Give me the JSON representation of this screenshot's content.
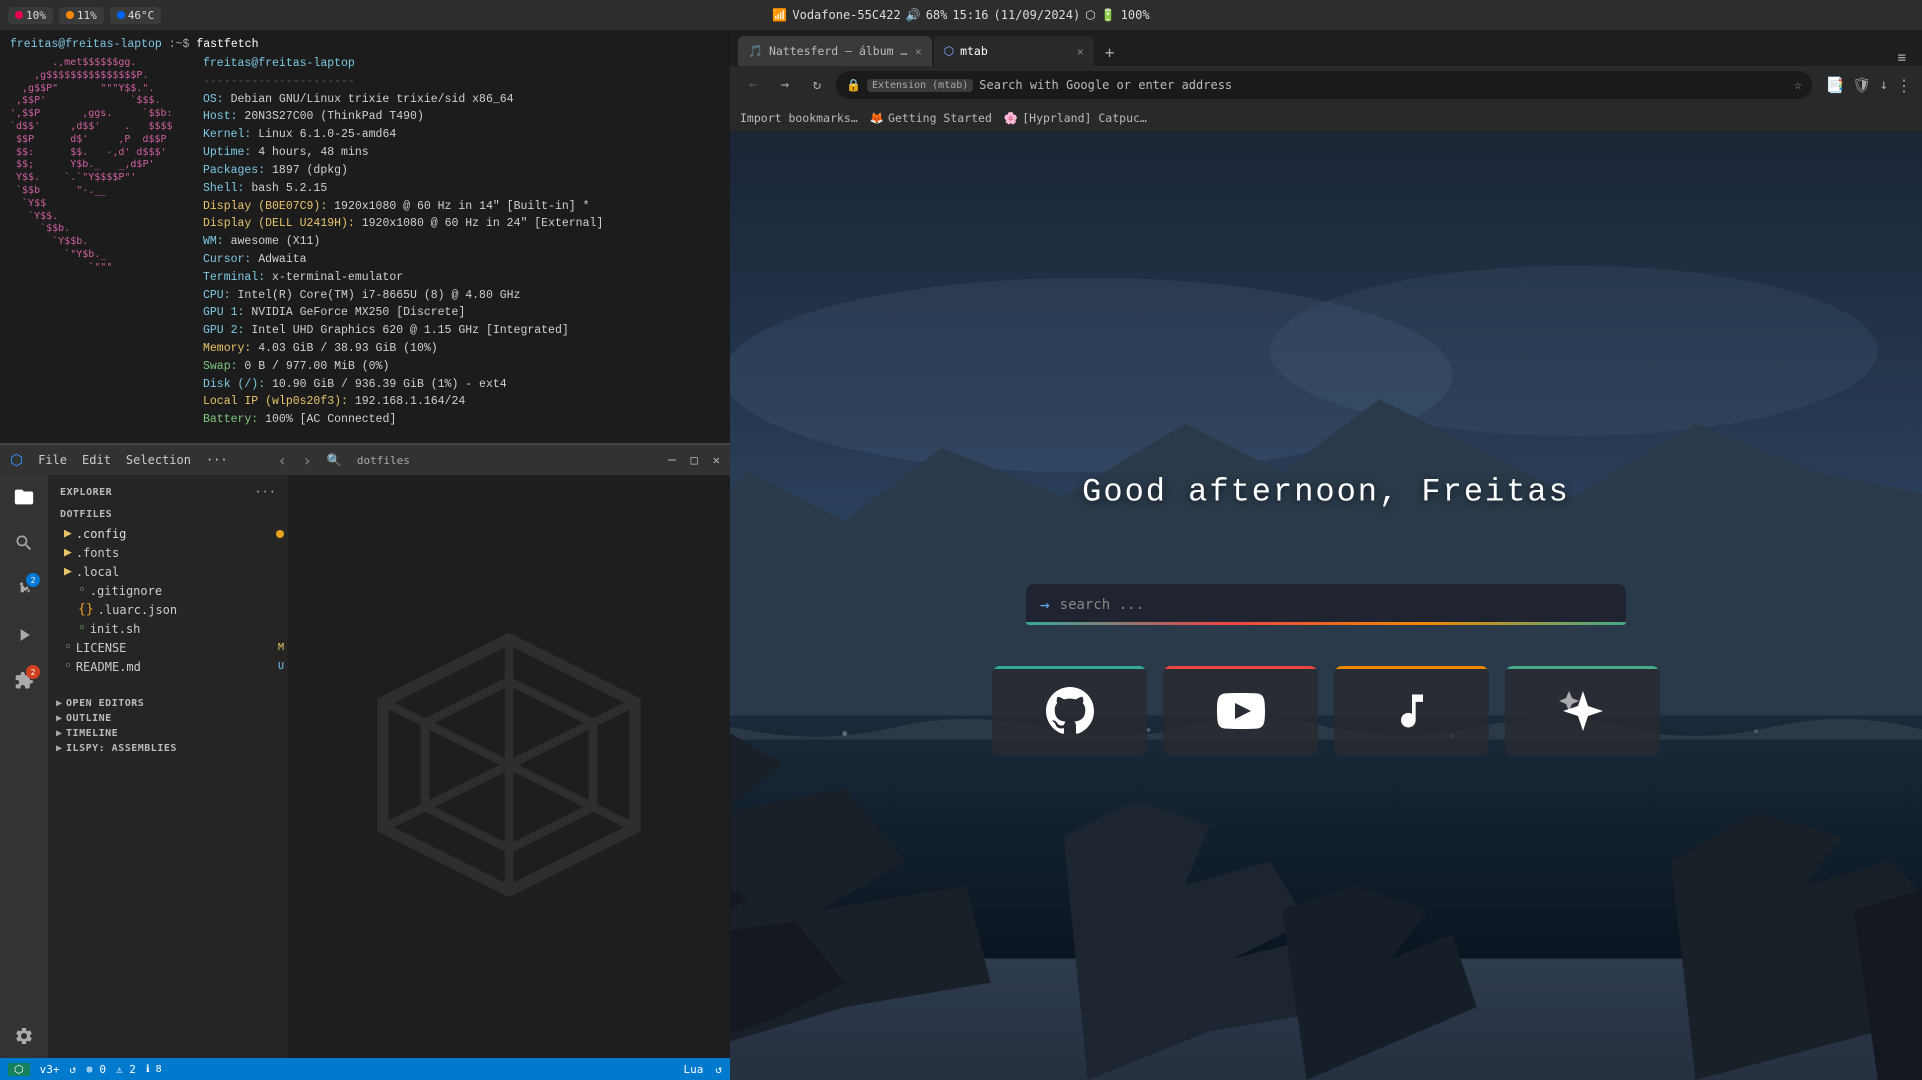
{
  "topbar": {
    "pills": [
      {
        "icon": "dot-red",
        "label": "10%",
        "name": "cpu-pill"
      },
      {
        "icon": "dot-orange",
        "label": "11%",
        "name": "ram-pill"
      },
      {
        "icon": "dot-blue",
        "label": "46°C",
        "name": "temp-pill"
      }
    ],
    "center": {
      "network_icon": "wifi",
      "network_label": "Vodafone-55C422",
      "volume_icon": "speaker",
      "volume_label": "68%",
      "clock": "15:16",
      "date": "(11/09/2024)",
      "bluetooth_icon": "bluetooth",
      "battery_icon": "battery",
      "battery_label": "100%"
    }
  },
  "terminal": {
    "prompt_user": "freitas@freitas-laptop",
    "prompt_path": ":~$",
    "command": "fastfetch",
    "ascii_art": [
      "       .,met$$$$$$gg.",
      "    ,g$$$$$$$$$$$$$$$P.",
      "  ,g$$P\"\"       \"\"\"Y$$.\".",
      " ,$$P'              `$$$.  ",
      "',$$P       ,ggs.     `$$b:",
      "`d$$'     ,d$$'    .   $$$$",
      " $$P      d$'     ,P  d$$P ",
      " $$:      $$.   -,d' d$$$' ",
      " $$;      Y$b._   _,d$P'   ",
      " Y$$.    `.`\"Y$$$$P\"'      ",
      " `$$b      \"-.__           ",
      "  `Y$$                     ",
      "   `Y$$.                   ",
      "     `$$b.                 ",
      "       `Y$$b.              ",
      "         `\"Y$b._           ",
      "             `\"\"\"          "
    ],
    "user_host": "freitas@freitas-laptop",
    "separator": "----------------------",
    "info": {
      "OS": "Debian GNU/Linux trixie trixie/sid x86_64",
      "Host": "20N3S27C00 (ThinkPad T490)",
      "Kernel": "Linux 6.1.0-25-amd64",
      "Uptime": "4 hours, 48 mins",
      "Packages": "1897 (dpkg)",
      "Shell": "bash 5.2.15",
      "Display1": "1920x1080 @ 60 Hz in 14\" [Built-in] *",
      "Display1_id": "(B0E07C9)",
      "Display2": "1920x1080 @ 60 Hz in 24\" [External]",
      "Display2_id": "(DELL U2419H)",
      "WM": "awesome (X11)",
      "Cursor": "Adwaita",
      "Terminal": "x-terminal-emulator",
      "CPU": "Intel(R) Core(TM) i7-8665U (8) @ 4.80 GHz",
      "GPU1": "NVIDIA GeForce MX250 [Discrete]",
      "GPU2": "Intel UHD Graphics 620 @ 1.15 GHz [Integrated]",
      "Memory": "4.03 GiB / 38.93 GiB (10%)",
      "Swap": "0 B / 977.00 MiB (0%)",
      "Disk": "10.90 GiB / 936.39 GiB (1%) - ext4",
      "LocalIP": "192.168.1.164/24",
      "LocalIP_iface": "wlp0s20f3",
      "Battery": "100% [AC Connected]"
    }
  },
  "vscode": {
    "title": "dotfiles",
    "search_placeholder": "dotfiles",
    "menu": [
      "File",
      "Edit",
      "Selection",
      "···"
    ],
    "nav_back": "‹",
    "nav_forward": "›",
    "sidebar": {
      "title": "EXPLORER",
      "more_icon": "···",
      "section": "DOTFILES",
      "tree": [
        {
          "indent": 1,
          "icon": "▶",
          "type": "folder",
          "name": ".config",
          "badge": "dot-orange"
        },
        {
          "indent": 1,
          "icon": "▶",
          "type": "folder",
          "name": ".fonts"
        },
        {
          "indent": 1,
          "icon": "▶",
          "type": "folder",
          "name": ".local"
        },
        {
          "indent": 2,
          "icon": "◦",
          "type": "file",
          "name": ".gitignore"
        },
        {
          "indent": 2,
          "icon": "{}",
          "type": "json",
          "name": ".luarc.json"
        },
        {
          "indent": 2,
          "icon": "◦",
          "type": "sh",
          "name": "init.sh"
        },
        {
          "indent": 1,
          "icon": "◦",
          "type": "file",
          "name": "LICENSE",
          "badge_label": "M"
        },
        {
          "indent": 1,
          "icon": "◦",
          "type": "file",
          "name": "README.md",
          "badge_label": "U"
        }
      ],
      "open_editors_title": "OPEN EDITORS",
      "outline_title": "OUTLINE",
      "timeline_title": "TIMELINE",
      "ilspy_title": "ILSPY: ASSEMBLIES"
    },
    "statusbar": {
      "branch": "v3+",
      "errors": "0",
      "warnings": "2",
      "info": "8",
      "lang": "Lua",
      "sync": "↺"
    }
  },
  "browser": {
    "tabs": [
      {
        "label": "Nattesferd – álbum de K…",
        "favicon": "🎵",
        "active": false
      },
      {
        "label": "mtab",
        "favicon": "⬡",
        "active": true
      }
    ],
    "add_tab": "+",
    "nav": {
      "back": "←",
      "forward": "→",
      "refresh": "↻"
    },
    "address": {
      "ext_label": "Extension (mtab)",
      "url": "Search with Google or enter address"
    },
    "bookmarks_icon": "⭐",
    "nav_icons": [
      "☆",
      "🛡",
      "↓",
      "⋮"
    ],
    "bookmarks": [
      {
        "label": "Import bookmarks…"
      },
      {
        "favicon": "🦊",
        "label": "Getting Started"
      },
      {
        "favicon": "🌸",
        "label": "[Hyprland] Catpuc…"
      }
    ],
    "page": {
      "greeting": "Good afternoon, Freitas",
      "search_placeholder": "search ...",
      "search_arrow": "→",
      "quick_links": [
        {
          "icon": "github",
          "unicode": "⊙",
          "type": "github"
        },
        {
          "icon": "youtube",
          "unicode": "▶",
          "type": "youtube"
        },
        {
          "icon": "music",
          "unicode": "♪",
          "type": "music"
        },
        {
          "icon": "ai",
          "unicode": "✦",
          "type": "ai"
        }
      ]
    }
  }
}
